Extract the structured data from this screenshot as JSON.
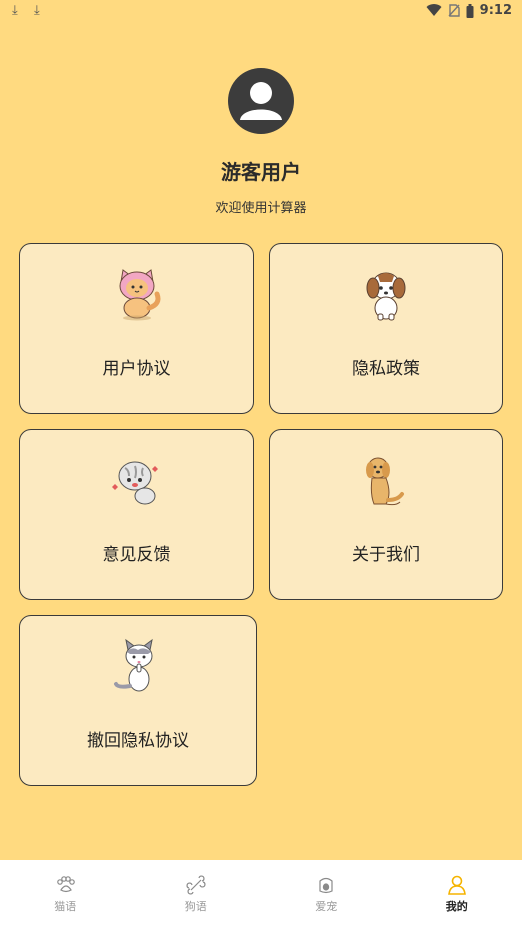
{
  "status_bar": {
    "time": "9:12"
  },
  "profile": {
    "name": "游客用户",
    "subtitle": "欢迎使用计算器"
  },
  "cards": [
    {
      "label": "用户协议",
      "icon": "pink-hood-cat-icon"
    },
    {
      "label": "隐私政策",
      "icon": "shihtzu-dog-icon"
    },
    {
      "label": "意见反馈",
      "icon": "scottish-fold-cat-icon"
    },
    {
      "label": "关于我们",
      "icon": "golden-retriever-icon"
    },
    {
      "label": "撤回隐私协议",
      "icon": "grey-white-cat-icon"
    }
  ],
  "tabs": [
    {
      "label": "猫语",
      "icon": "paw-icon",
      "active": false
    },
    {
      "label": "狗语",
      "icon": "bone-icon",
      "active": false
    },
    {
      "label": "爱宠",
      "icon": "pet-bowl-icon",
      "active": false
    },
    {
      "label": "我的",
      "icon": "user-icon",
      "active": true
    }
  ],
  "colors": {
    "background": "#FFDA80",
    "card": "#FCEAC1",
    "active_tab": "#F5B400"
  }
}
